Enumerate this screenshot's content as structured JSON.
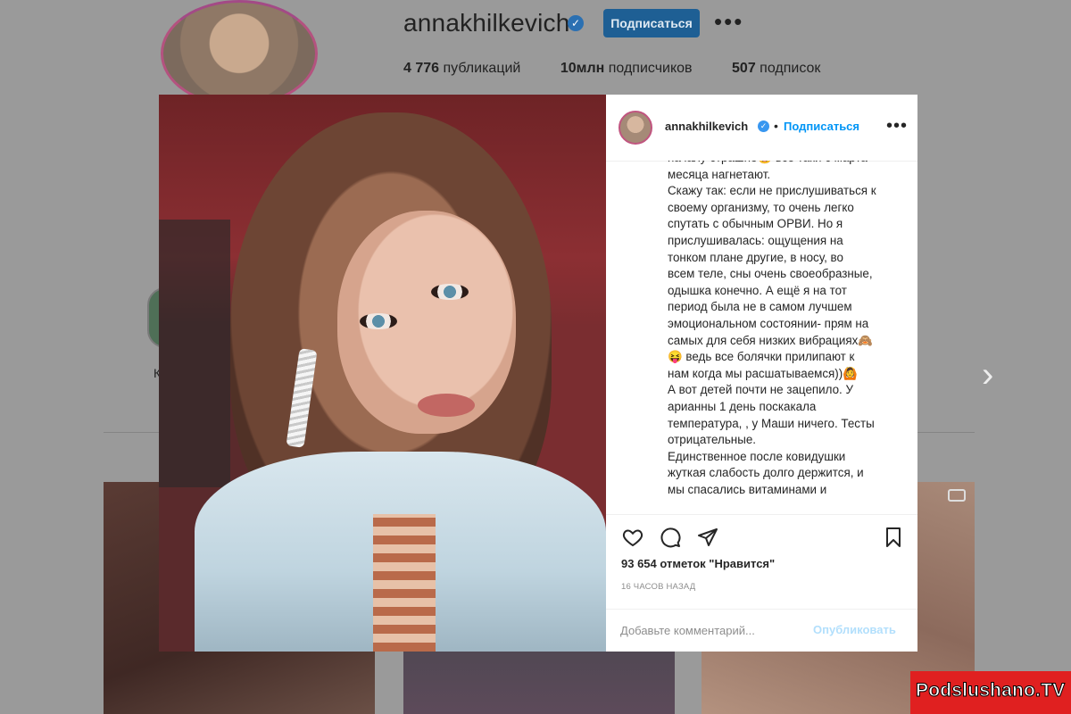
{
  "profile": {
    "username": "annakhilkevich",
    "verified_mark": "✓",
    "follow_label": "Подписаться",
    "more_label": "•••",
    "stats": [
      {
        "value": "4 776",
        "label": "публикаций"
      },
      {
        "value": "10млн",
        "label": "подписчиков"
      },
      {
        "value": "507",
        "label": "подписок"
      }
    ],
    "highlight_letter": "К"
  },
  "post": {
    "username": "annakhilkevich",
    "verified_mark": "✓",
    "separator": "•",
    "follow_label": "Подписаться",
    "more_label": "•••",
    "caption": "началу страшно😄 все таки с марта\nмесяца нагнетают.\nСкажу так: если не прислушиваться к\nсвоему организму, то очень легко\nспутать с обычным ОРВИ. Но я\nприслушивалась: ощущения на\nтонком плане другие, в носу, во\nвсем теле, сны очень своеобразные,\nодышка конечно. А ещё я на тот\nпериод была не в самом лучшем\nэмоциональном состоянии- прям на\nсамых для себя низких вибрациях🙈\n😝 ведь все болячки прилипают к\nнам когда мы расшатываемся))🙆\nА вот детей почти не зацепило. У\nарианны 1 день поскакала\nтемпература, , у Маши ничего. Тесты\nотрицательные.\nЕдинственное после ковидушки\nжуткая слабость долго держится, и\nмы спасались витаминами и",
    "likes": "93 654 отметок \"Нравится\"",
    "time": "16 ЧАСОВ НАЗАД",
    "comment_placeholder": "Добавьте комментарий...",
    "publish_label": "Опубликовать",
    "icons": [
      "heart-icon",
      "comment-icon",
      "share-icon",
      "bookmark-icon"
    ]
  },
  "gallery": {
    "next_label": "›"
  },
  "watermark": {
    "text": "Podslushano.TV"
  },
  "colors": {
    "accent": "#0095f6",
    "publish_disabled": "#b2dffc",
    "watermark_bg": "#e02020"
  }
}
